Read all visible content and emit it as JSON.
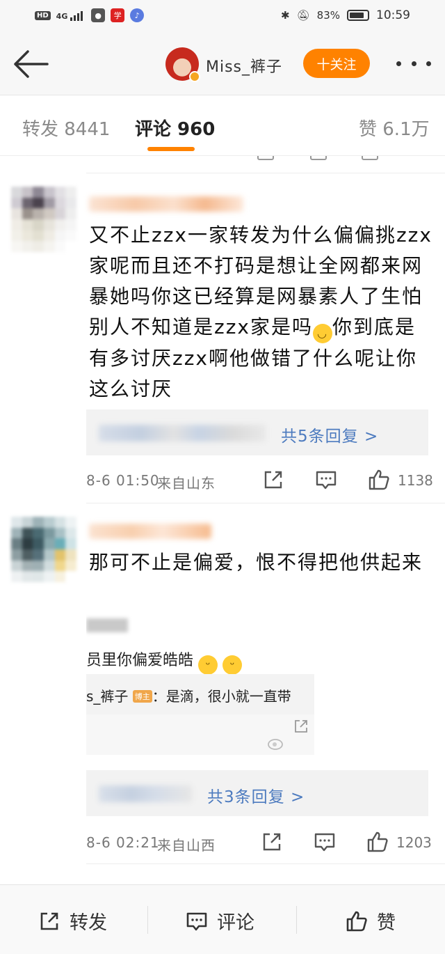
{
  "status_bar": {
    "left_badge": "HD",
    "network": "4G",
    "battery": "83%",
    "battery_level": 0.83,
    "time": "10:59"
  },
  "header": {
    "username": "Miss_裤子",
    "follow_label": "十关注"
  },
  "tabs": [
    {
      "label": "转发 8441"
    },
    {
      "label": "评论 960"
    },
    {
      "label": "赞 6.1万"
    }
  ],
  "comments": [
    {
      "text": "又不止zzx一家转发为什么偏偏挑zzx家呢而且还不打码是想让全网都来网暴她吗你这已经算是网暴素人了生怕别人不知道是zzx家是吗",
      "text_after_emoji": "你到底是有多讨厌zzx啊他做错了什么呢让你这么讨厌",
      "reply_link": "共5条回复 >",
      "time": "8-6 01:50",
      "source": "来自山东",
      "likes": "1138"
    },
    {
      "text": "那可不止是偏爱，恨不得把他供起来",
      "embedded_image": {
        "line1": "员里你偏爱皓皓",
        "quote_prefix": "s_裤子",
        "host_badge": "博主",
        "quote_text": "：是滴，很小就一直带"
      },
      "reply_link": "共3条回复 >",
      "time": "8-6 02:21",
      "source": "来自山西",
      "likes": "1203"
    }
  ],
  "bottom_bar": {
    "repost": "转发",
    "comment": "评论",
    "like": "赞"
  },
  "colors": {
    "accent": "#ff8200",
    "link": "#4d7bbf"
  }
}
